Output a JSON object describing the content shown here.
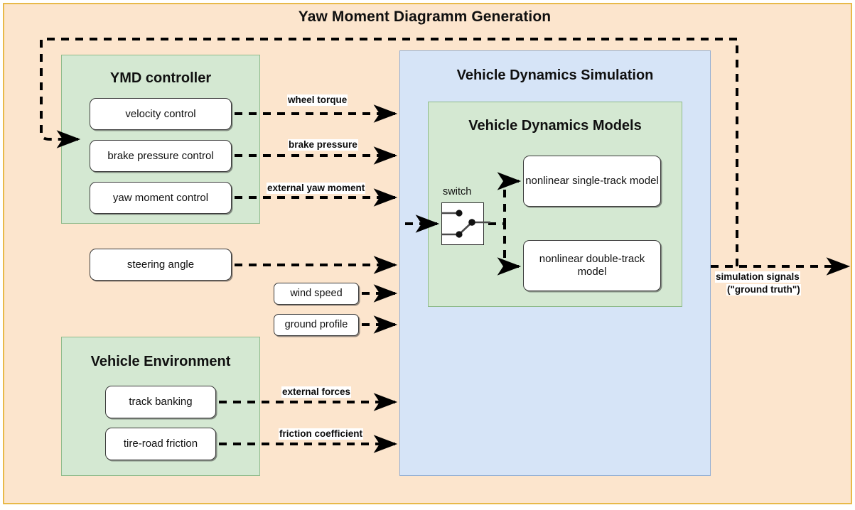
{
  "diagram": {
    "title": "Yaw Moment Diagramm Generation",
    "colors": {
      "outer_fill": "#FCE5CD",
      "outer_border": "#E8B949",
      "group_green_fill": "#D4E8D2",
      "group_green_border": "#8FBB8B",
      "group_blue_fill": "#D6E4F7",
      "group_blue_border": "#93AFD4",
      "node_fill": "#FFFFFF",
      "node_border": "#3A3A3A",
      "edge": "#000000"
    },
    "groups": {
      "ymd_controller": {
        "title": "YMD controller",
        "nodes": [
          {
            "label": "velocity control"
          },
          {
            "label": "brake pressure control"
          },
          {
            "label": "yaw moment control"
          }
        ]
      },
      "vehicle_environment": {
        "title": "Vehicle Environment",
        "nodes": [
          {
            "label": "track banking"
          },
          {
            "label": "tire-road friction"
          }
        ]
      },
      "vehicle_dynamics_simulation": {
        "title": "Vehicle Dynamics Simulation",
        "inner": {
          "title": "Vehicle Dynamics Models",
          "switch_label": "switch",
          "nodes": [
            {
              "label": "nonlinear single-track model"
            },
            {
              "label": "nonlinear double-track model"
            }
          ]
        }
      }
    },
    "standalone_nodes": [
      {
        "label": "steering angle"
      },
      {
        "label": "wind speed"
      },
      {
        "label": "ground profile"
      }
    ],
    "edge_labels": [
      {
        "text": "wheel torque"
      },
      {
        "text": "brake pressure"
      },
      {
        "text": "external yaw moment"
      },
      {
        "text": "external forces"
      },
      {
        "text": "friction coefficient"
      }
    ],
    "output_label": {
      "line1": "simulation signals",
      "line2": "(\"ground truth\")"
    }
  }
}
